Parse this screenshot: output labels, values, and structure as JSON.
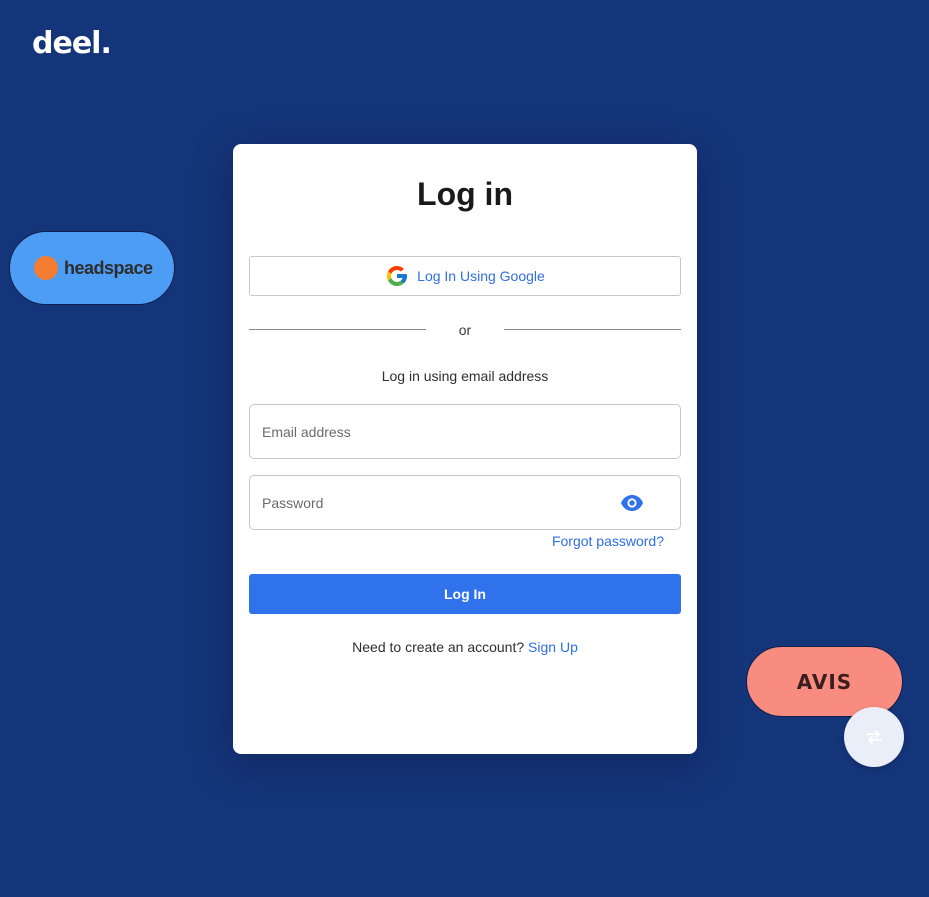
{
  "brand": {
    "logo_text": "deel."
  },
  "floating_logos": {
    "headspace": "headspace",
    "avis": "AVIS"
  },
  "login": {
    "title": "Log in",
    "google_button_label": "Log In Using Google",
    "divider_text": "or",
    "email_caption": "Log in using email address",
    "email_placeholder": "Email address",
    "password_placeholder": "Password",
    "forgot_password_label": "Forgot password?",
    "submit_label": "Log In",
    "signup_prompt": "Need to create an account?",
    "signup_link_label": "Sign Up"
  },
  "icons": {
    "google": "google-g-icon",
    "eye": "eye-icon",
    "floating": "swap-arrows-icon"
  },
  "colors": {
    "background": "#15357a",
    "accent": "#2f72ec",
    "link": "#2f6fe4",
    "headspace_pill": "#4d9df5",
    "headspace_dot": "#f47d31",
    "avis_pill": "#f98c80"
  }
}
